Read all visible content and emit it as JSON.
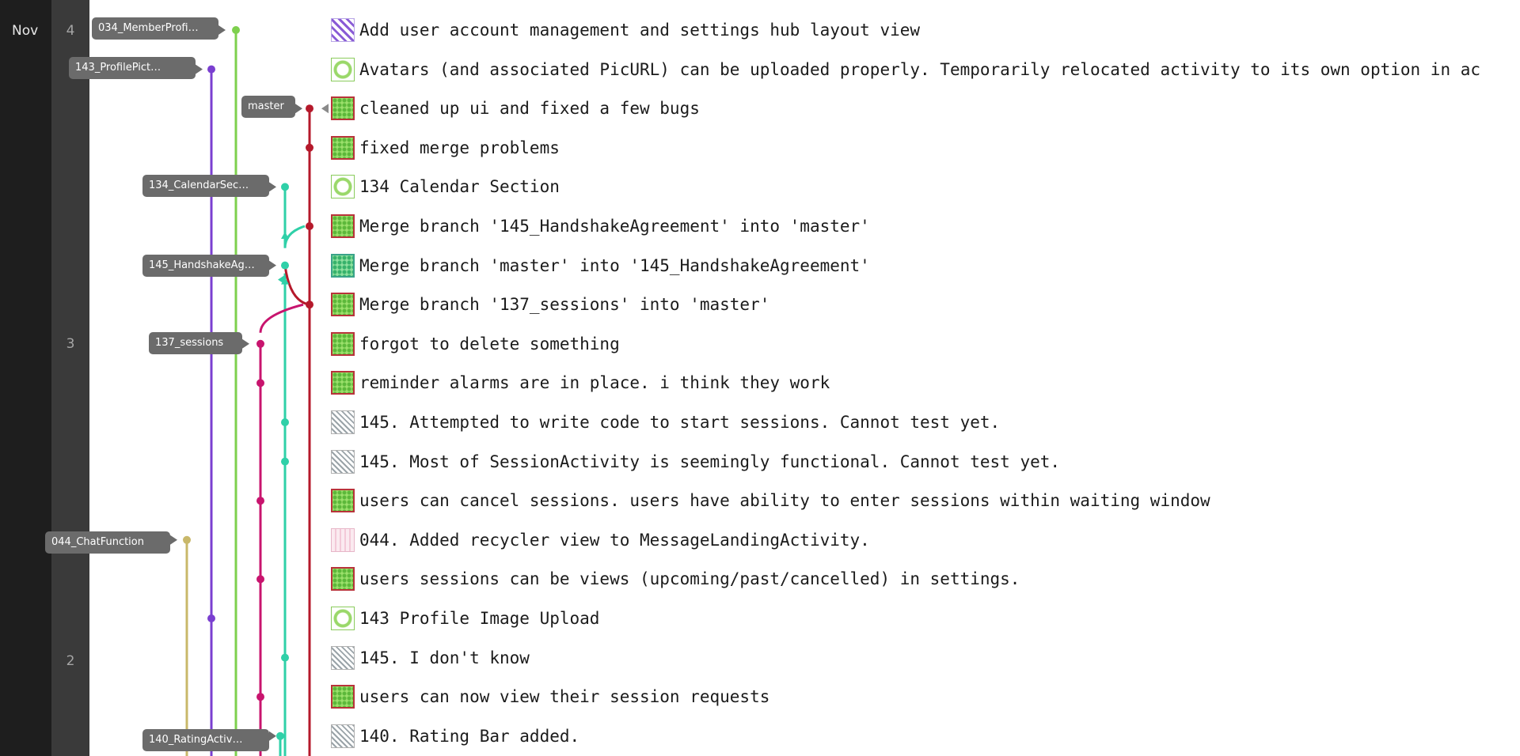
{
  "date_column": {
    "month": "Nov",
    "days": [
      {
        "label": "4",
        "row": 0
      },
      {
        "label": "3",
        "row": 8
      },
      {
        "label": "2",
        "row": 16
      }
    ]
  },
  "branches": [
    {
      "label": "034_MemberProfi…",
      "row": 0,
      "lane": "green"
    },
    {
      "label": "143_ProfilePict…",
      "row": 1,
      "lane": "purple"
    },
    {
      "label": "master",
      "row": 2,
      "lane": "red"
    },
    {
      "label": "134_CalendarSec…",
      "row": 4,
      "lane": "teal"
    },
    {
      "label": "145_HandshakeAg…",
      "row": 6,
      "lane": "teal"
    },
    {
      "label": "137_sessions",
      "row": 8,
      "lane": "magenta"
    },
    {
      "label": "044_ChatFunction",
      "row": 13,
      "lane": "olive"
    },
    {
      "label": "140_RatingActiv…",
      "row": 18,
      "lane": "teal"
    }
  ],
  "lane_colors": {
    "green": "#7ed04e",
    "purple": "#7a3fd0",
    "red": "#b5192b",
    "teal": "#2fd0a8",
    "magenta": "#c8146e",
    "olive": "#c9b86a"
  },
  "commits": [
    {
      "message": "Add user account management and settings hub layout view",
      "avatar": "purple-pattern-avatar"
    },
    {
      "message": "Avatars (and associated PicURL) can be uploaded properly. Temporarily relocated activity to its own option in ac",
      "avatar": "green-ring-avatar"
    },
    {
      "message": "cleaned up ui and fixed a few bugs",
      "avatar": "green-grid-avatar"
    },
    {
      "message": "fixed merge problems",
      "avatar": "green-grid-avatar"
    },
    {
      "message": "134 Calendar Section",
      "avatar": "green-ring-avatar"
    },
    {
      "message": "Merge branch '145_HandshakeAgreement' into 'master'",
      "avatar": "green-grid-avatar"
    },
    {
      "message": "Merge branch 'master' into '145_HandshakeAgreement'",
      "avatar": "green-teal-avatar"
    },
    {
      "message": "Merge branch '137_sessions' into 'master'",
      "avatar": "green-grid-avatar"
    },
    {
      "message": "forgot to delete something",
      "avatar": "green-grid-avatar"
    },
    {
      "message": "reminder alarms are in place. i think they work",
      "avatar": "green-grid-avatar"
    },
    {
      "message": "145. Attempted to write code to start sessions. Cannot test yet.",
      "avatar": "gray-pattern-avatar"
    },
    {
      "message": "145. Most of SessionActivity is seemingly functional. Cannot test yet.",
      "avatar": "gray-pattern-avatar"
    },
    {
      "message": "users can cancel sessions. users have ability to enter sessions within waiting window",
      "avatar": "green-grid-avatar"
    },
    {
      "message": "044. Added recycler view to MessageLandingActivity.",
      "avatar": "pink-pattern-avatar"
    },
    {
      "message": "users sessions can be views (upcoming/past/cancelled) in settings.",
      "avatar": "green-grid-avatar"
    },
    {
      "message": "143 Profile Image Upload",
      "avatar": "green-ring-avatar"
    },
    {
      "message": "145. I don't know",
      "avatar": "gray-pattern-avatar"
    },
    {
      "message": "users can now view their session requests",
      "avatar": "green-grid-avatar"
    },
    {
      "message": "140. Rating Bar added.",
      "avatar": "gray-pattern-avatar"
    }
  ]
}
